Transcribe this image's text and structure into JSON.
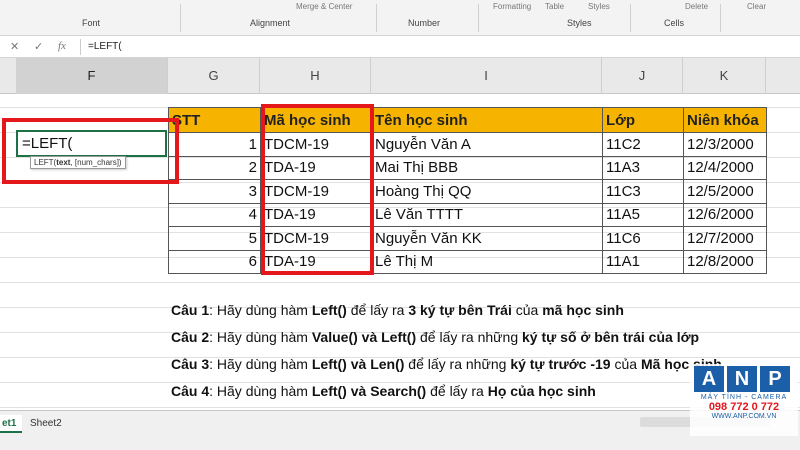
{
  "ribbon": {
    "groups": [
      "Font",
      "Alignment",
      "Number",
      "Styles",
      "Cells"
    ],
    "top_items": [
      "Merge & Center",
      "Formatting",
      "Table",
      "Styles",
      "Delete",
      "Clear"
    ]
  },
  "formula_bar": {
    "value": "=LEFT("
  },
  "columns": [
    "F",
    "G",
    "H",
    "I",
    "J",
    "K"
  ],
  "selected_column": "F",
  "table": {
    "headers": [
      "STT",
      "Mã học sinh",
      "Tên học sinh",
      "Lớp",
      "Niên khóa"
    ],
    "rows": [
      [
        "1",
        "TDCM-19",
        "Nguyễn Văn A",
        "11C2",
        "12/3/2000"
      ],
      [
        "2",
        "TDA-19",
        "Mai Thị BBB",
        "11A3",
        "12/4/2000"
      ],
      [
        "3",
        "TDCM-19",
        "Hoàng Thị QQ",
        "11C3",
        "12/5/2000"
      ],
      [
        "4",
        "TDA-19",
        "Lê Văn TTTT",
        "11A5",
        "12/6/2000"
      ],
      [
        "5",
        "TDCM-19",
        "Nguyễn Văn KK",
        "11C6",
        "12/7/2000"
      ],
      [
        "6",
        "TDA-19",
        "Lê Thị M",
        "11A1",
        "12/8/2000"
      ]
    ]
  },
  "edit_cell": {
    "value": "=LEFT(",
    "tooltip_fn": "LEFT(",
    "tooltip_arg1": "text",
    "tooltip_rest": ", [num_chars])"
  },
  "questions": [
    {
      "label": "Câu 1",
      "parts": [
        ": Hãy dùng hàm ",
        "Left()",
        " để lấy ra ",
        "3 ký tự bên Trái",
        " của ",
        "mã học sinh"
      ]
    },
    {
      "label": "Câu 2",
      "parts": [
        ": Hãy dùng hàm ",
        "Value() và Left()",
        " để lấy ra những ",
        "ký tự số ở bên trái của lớp",
        "",
        ""
      ]
    },
    {
      "label": "Câu 3",
      "parts": [
        ": Hãy dùng hàm ",
        "Left() và Len()",
        " để lấy ra  những ",
        "ký tự trước -19",
        " của ",
        "Mã học sinh"
      ]
    },
    {
      "label": "Câu 4",
      "parts": [
        ": Hãy dùng hàm ",
        "Left() và Search()",
        " để lấy ra ",
        "Họ của học sinh",
        "",
        ""
      ]
    }
  ],
  "sheets": [
    "et1",
    "Sheet2"
  ],
  "active_sheet": "et1",
  "logo": {
    "letters": [
      "A",
      "N",
      "P"
    ],
    "line1": "MÁY TÍNH - CAMERA",
    "line2": "098 772 0 772",
    "line3": "WWW.ANP.COM.VN"
  },
  "colors": {
    "header_fill": "#f6b400",
    "highlight_box": "#e4171b",
    "active_cell_border": "#1e7145"
  }
}
